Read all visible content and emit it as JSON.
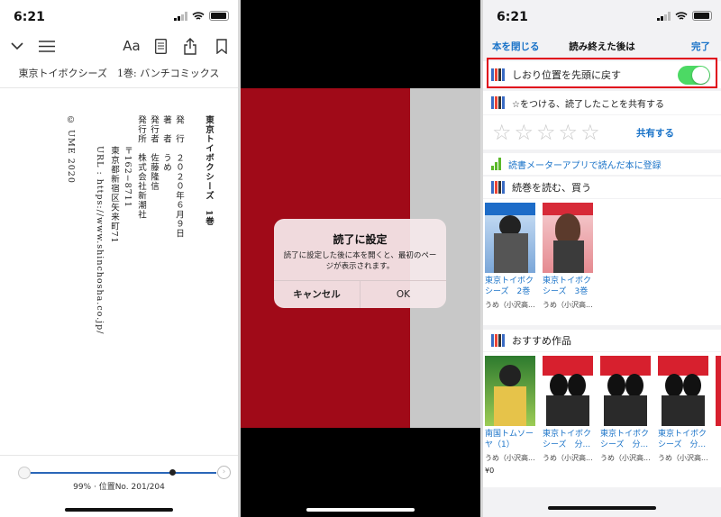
{
  "panel1": {
    "status": {
      "time": "6:21"
    },
    "booktitle": "東京トイボクシーズ　1巻: バンチコミックス",
    "colophon": {
      "title": "東京トイボクシーズ　1巻",
      "issue": "発　行　２０２０年６月９日",
      "author": "著　者　うめ",
      "publisher_person": "発行者　佐藤隆信",
      "publisher": "発行所　株式会社新潮社",
      "zip": "〒162−8711",
      "address": "東京都新宿区矢来町71",
      "url": "URL : https://www.shinchosha.co.jp/",
      "copyright": "© UME 2020"
    },
    "progress_text": "99% · 位置No. 201/204",
    "progress_fraction": 0.99
  },
  "panel2": {
    "alert": {
      "title": "読了に設定",
      "message": "読了に設定した後に本を開くと、最初のページが表示されます。",
      "cancel": "キャンセル",
      "ok": "OK"
    }
  },
  "panel3": {
    "status": {
      "time": "6:21"
    },
    "nav": {
      "left": "本を閉じる",
      "title": "読み終えた後は",
      "right": "完了"
    },
    "bookmark_reset": "しおり位置を先頭に戻す",
    "share_heading": "☆をつける、読了したことを共有する",
    "share_button": "共有する",
    "meter": "読書メーターアプリで読んだ本に登録",
    "series_heading": "続巻を読む、買う",
    "series_books": [
      {
        "title": "東京トイボク\nシーズ　2巻",
        "author": "うめ（小沢高..."
      },
      {
        "title": "東京トイボク\nシーズ　3巻",
        "author": "うめ（小沢高..."
      }
    ],
    "recommend_heading": "おすすめ作品",
    "recommend_books": [
      {
        "title": "南国トムソー\nヤ（1）",
        "author": "うめ（小沢高...",
        "price": "¥0"
      },
      {
        "title": "東京トイボク\nシーズ　分...",
        "author": "うめ（小沢高..."
      },
      {
        "title": "東京トイボク\nシーズ　分...",
        "author": "うめ（小沢高..."
      },
      {
        "title": "東京トイボク\nシーズ　分...",
        "author": "うめ（小沢高..."
      }
    ],
    "colors": {
      "accent": "#1a73c8",
      "toggle": "#4cd964",
      "highlight": "#e0001a"
    }
  }
}
